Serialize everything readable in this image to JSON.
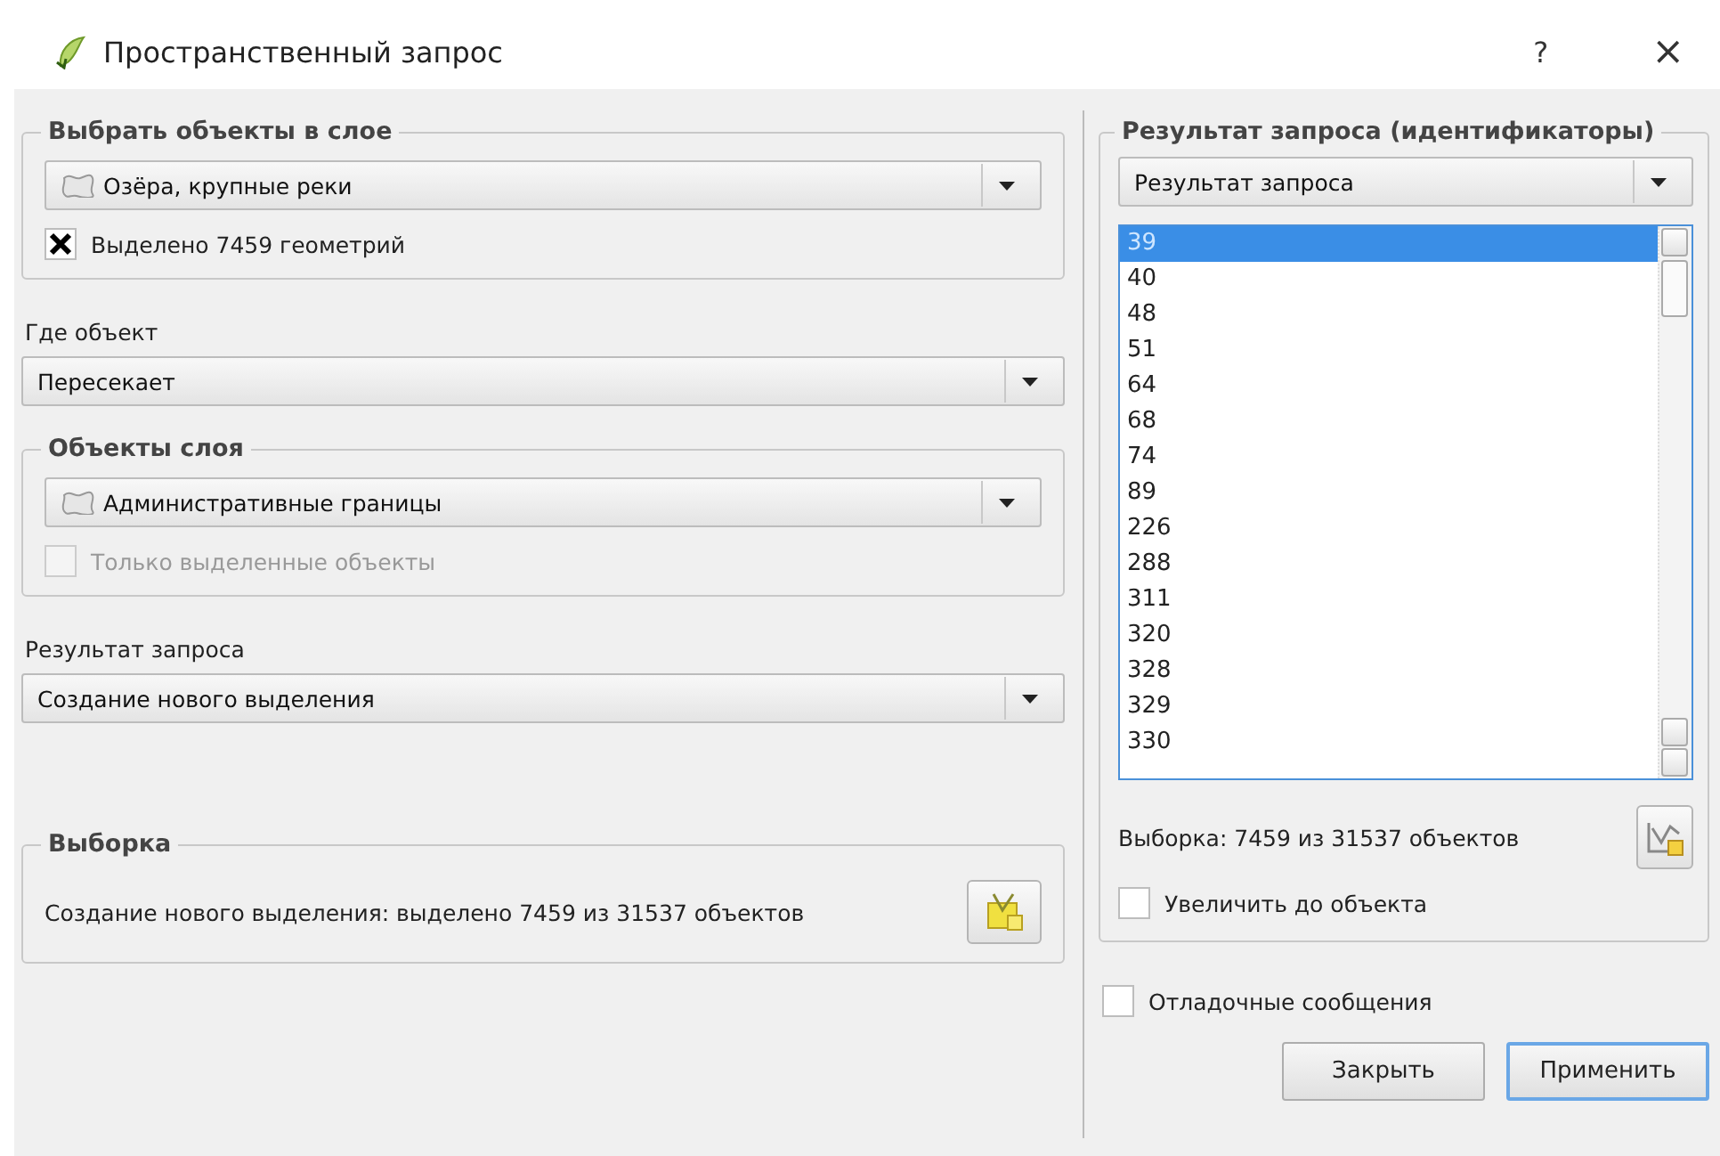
{
  "window": {
    "title": "Пространственный запрос",
    "help": "?",
    "close": "×"
  },
  "select_group": {
    "title": "Выбрать объекты в слое",
    "layer": "Озёра, крупные реки",
    "checkbox": {
      "label": "Выделено 7459 геометрий",
      "checked": true,
      "disabled": false
    }
  },
  "where": {
    "label": "Где объект",
    "value": "Пересекает"
  },
  "ref_group": {
    "title": "Объекты слоя",
    "layer": "Административные границы",
    "checkbox": {
      "label": "Только выделенные объекты",
      "checked": false,
      "disabled": true
    }
  },
  "result": {
    "label": "Результат запроса",
    "value": "Создание нового выделения"
  },
  "selection_group": {
    "title": "Выборка",
    "text": "Создание нового выделения: выделено 7459 из 31537 объектов"
  },
  "ids_group": {
    "title": "Результат запроса (идентификаторы)",
    "combo": "Результат запроса",
    "items": [
      {
        "label": "39",
        "selected": true
      },
      {
        "label": "40",
        "selected": false
      },
      {
        "label": "48",
        "selected": false
      },
      {
        "label": "51",
        "selected": false
      },
      {
        "label": "64",
        "selected": false
      },
      {
        "label": "68",
        "selected": false
      },
      {
        "label": "74",
        "selected": false
      },
      {
        "label": "89",
        "selected": false
      },
      {
        "label": "226",
        "selected": false
      },
      {
        "label": "288",
        "selected": false
      },
      {
        "label": "311",
        "selected": false
      },
      {
        "label": "320",
        "selected": false
      },
      {
        "label": "328",
        "selected": false
      },
      {
        "label": "329",
        "selected": false
      },
      {
        "label": "330",
        "selected": false
      }
    ],
    "count": "Выборка: 7459 из 31537 объектов",
    "zoom_checkbox": {
      "label": "Увеличить до объекта",
      "checked": false,
      "disabled": false
    }
  },
  "debug_checkbox": {
    "label": "Отладочные сообщения",
    "checked": false,
    "disabled": false
  },
  "buttons": [
    {
      "label": "Закрыть",
      "default": false
    },
    {
      "label": "Применить",
      "default": true
    }
  ]
}
